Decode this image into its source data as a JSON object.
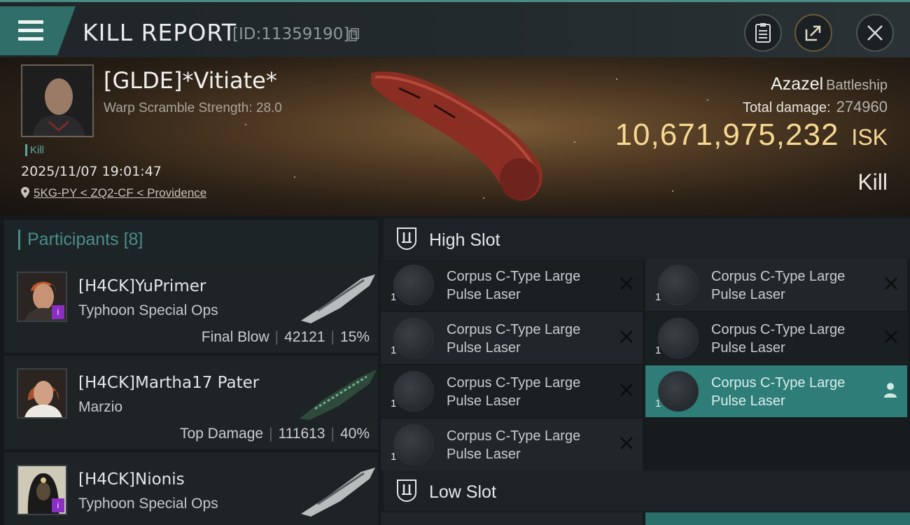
{
  "header": {
    "title": "KILL REPORT",
    "report_id": "[ID:11359190]"
  },
  "victim": {
    "name": "[GLDE]*Vitiate*",
    "warp": "Warp Scramble Strength: 28.0",
    "kill_tag": "Kill",
    "datetime": "2025/11/07 19:01:47",
    "location": "5KG-PY < ZQ2-CF < Providence",
    "ship": "Azazel",
    "ship_class": "Battleship",
    "total_damage_label": "Total damage:",
    "total_damage": "274960",
    "isk_value": "10,671,975,232",
    "isk_unit": "ISK",
    "result": "Kill"
  },
  "participants": {
    "label": "Participants",
    "count": "[8]",
    "items": [
      {
        "name": "[H4CK]YuPrimer",
        "ship": "Typhoon Special Ops",
        "role": "Final Blow",
        "damage": "42121",
        "percent": "15%"
      },
      {
        "name": "[H4CK]Martha17 Pater",
        "ship": "Marzio",
        "role": "Top Damage",
        "damage": "111613",
        "percent": "40%"
      },
      {
        "name": "[H4CK]Nionis",
        "ship": "Typhoon Special Ops",
        "role": "",
        "damage": "",
        "percent": ""
      }
    ]
  },
  "fitting": {
    "high_slot_label": "High Slot",
    "low_slot_label": "Low Slot",
    "modules": [
      {
        "line1": "Corpus C-Type Large",
        "line2": "Pulse Laser",
        "qty": "1"
      },
      {
        "line1": "Corpus C-Type Large",
        "line2": "Pulse Laser",
        "qty": "1"
      },
      {
        "line1": "Corpus C-Type Large",
        "line2": "Pulse Laser",
        "qty": "1"
      },
      {
        "line1": "Corpus C-Type Large",
        "line2": "Pulse Laser",
        "qty": "1"
      },
      {
        "line1": "Corpus C-Type Large",
        "line2": "Pulse Laser",
        "qty": "1"
      },
      {
        "line1": "Corpus C-Type Large",
        "line2": "Pulse Laser",
        "qty": "1"
      },
      {
        "line1": "Corpus C-Type Large",
        "line2": "Pulse Laser",
        "qty": "1"
      }
    ]
  },
  "colors": {
    "accent": "#2f7d78",
    "isk": "#f6d892",
    "badge": "#8b2fc4"
  }
}
